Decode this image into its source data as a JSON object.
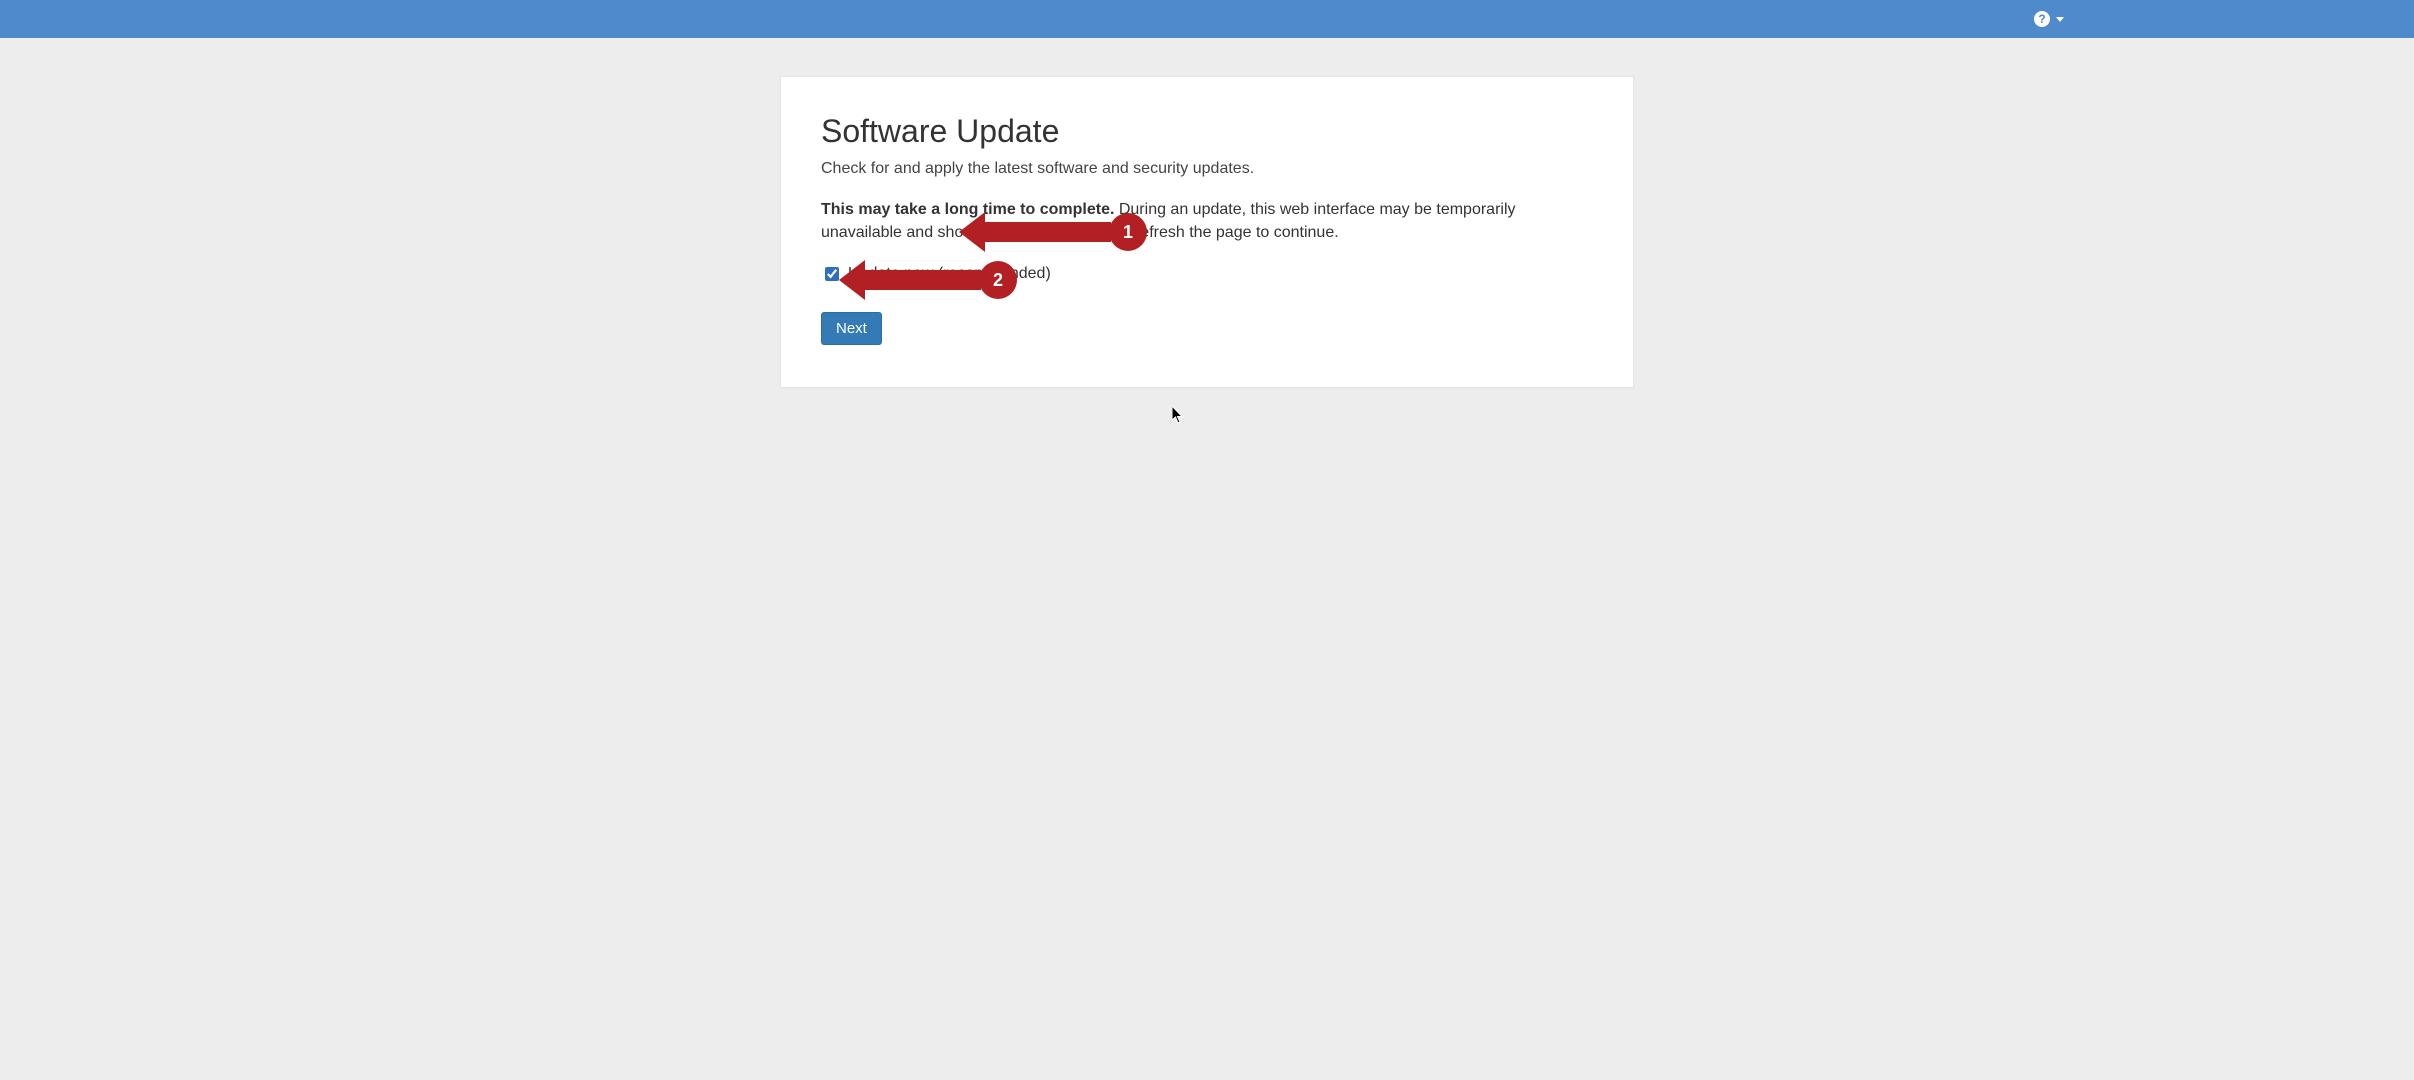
{
  "header": {
    "help_tooltip": "Help"
  },
  "card": {
    "title": "Software Update",
    "subtitle": "Check for and apply the latest software and security updates.",
    "warning_bold": "This may take a long time to complete.",
    "warning_rest": " During an update, this web interface may be temporarily unavailable and show an error. In that case, refresh the page to continue.",
    "checkbox_label": "Update now (recommended)",
    "checkbox_checked": true,
    "next_button": "Next"
  },
  "annotations": {
    "a1": "1",
    "a2": "2"
  }
}
